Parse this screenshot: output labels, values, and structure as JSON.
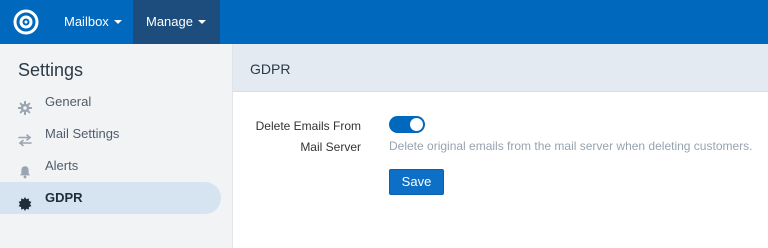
{
  "navbar": {
    "logo_icon": "helpdesk-logo-icon",
    "items": [
      {
        "label": "Mailbox",
        "icon": "caret-down-icon"
      },
      {
        "label": "Manage",
        "icon": "caret-down-icon",
        "active": true
      }
    ],
    "background": "#0068bd",
    "active_background": "#1c4d7c"
  },
  "sidebar": {
    "title": "Settings",
    "items": [
      {
        "label": "General",
        "icon": "gear-icon"
      },
      {
        "label": "Mail Settings",
        "icon": "arrows-exchange-icon"
      },
      {
        "label": "Alerts",
        "icon": "bell-icon"
      },
      {
        "label": "GDPR",
        "icon": "badge-star-icon",
        "active": true
      }
    ],
    "active_background": "#d6e4f1"
  },
  "main": {
    "title": "GDPR",
    "field": {
      "label_line1": "Delete Emails From",
      "label_line2": "Mail Server",
      "toggle_on": true,
      "help_text": "Delete original emails from the mail server when deleting customers."
    },
    "save_label": "Save",
    "accent": "#0068bd"
  }
}
